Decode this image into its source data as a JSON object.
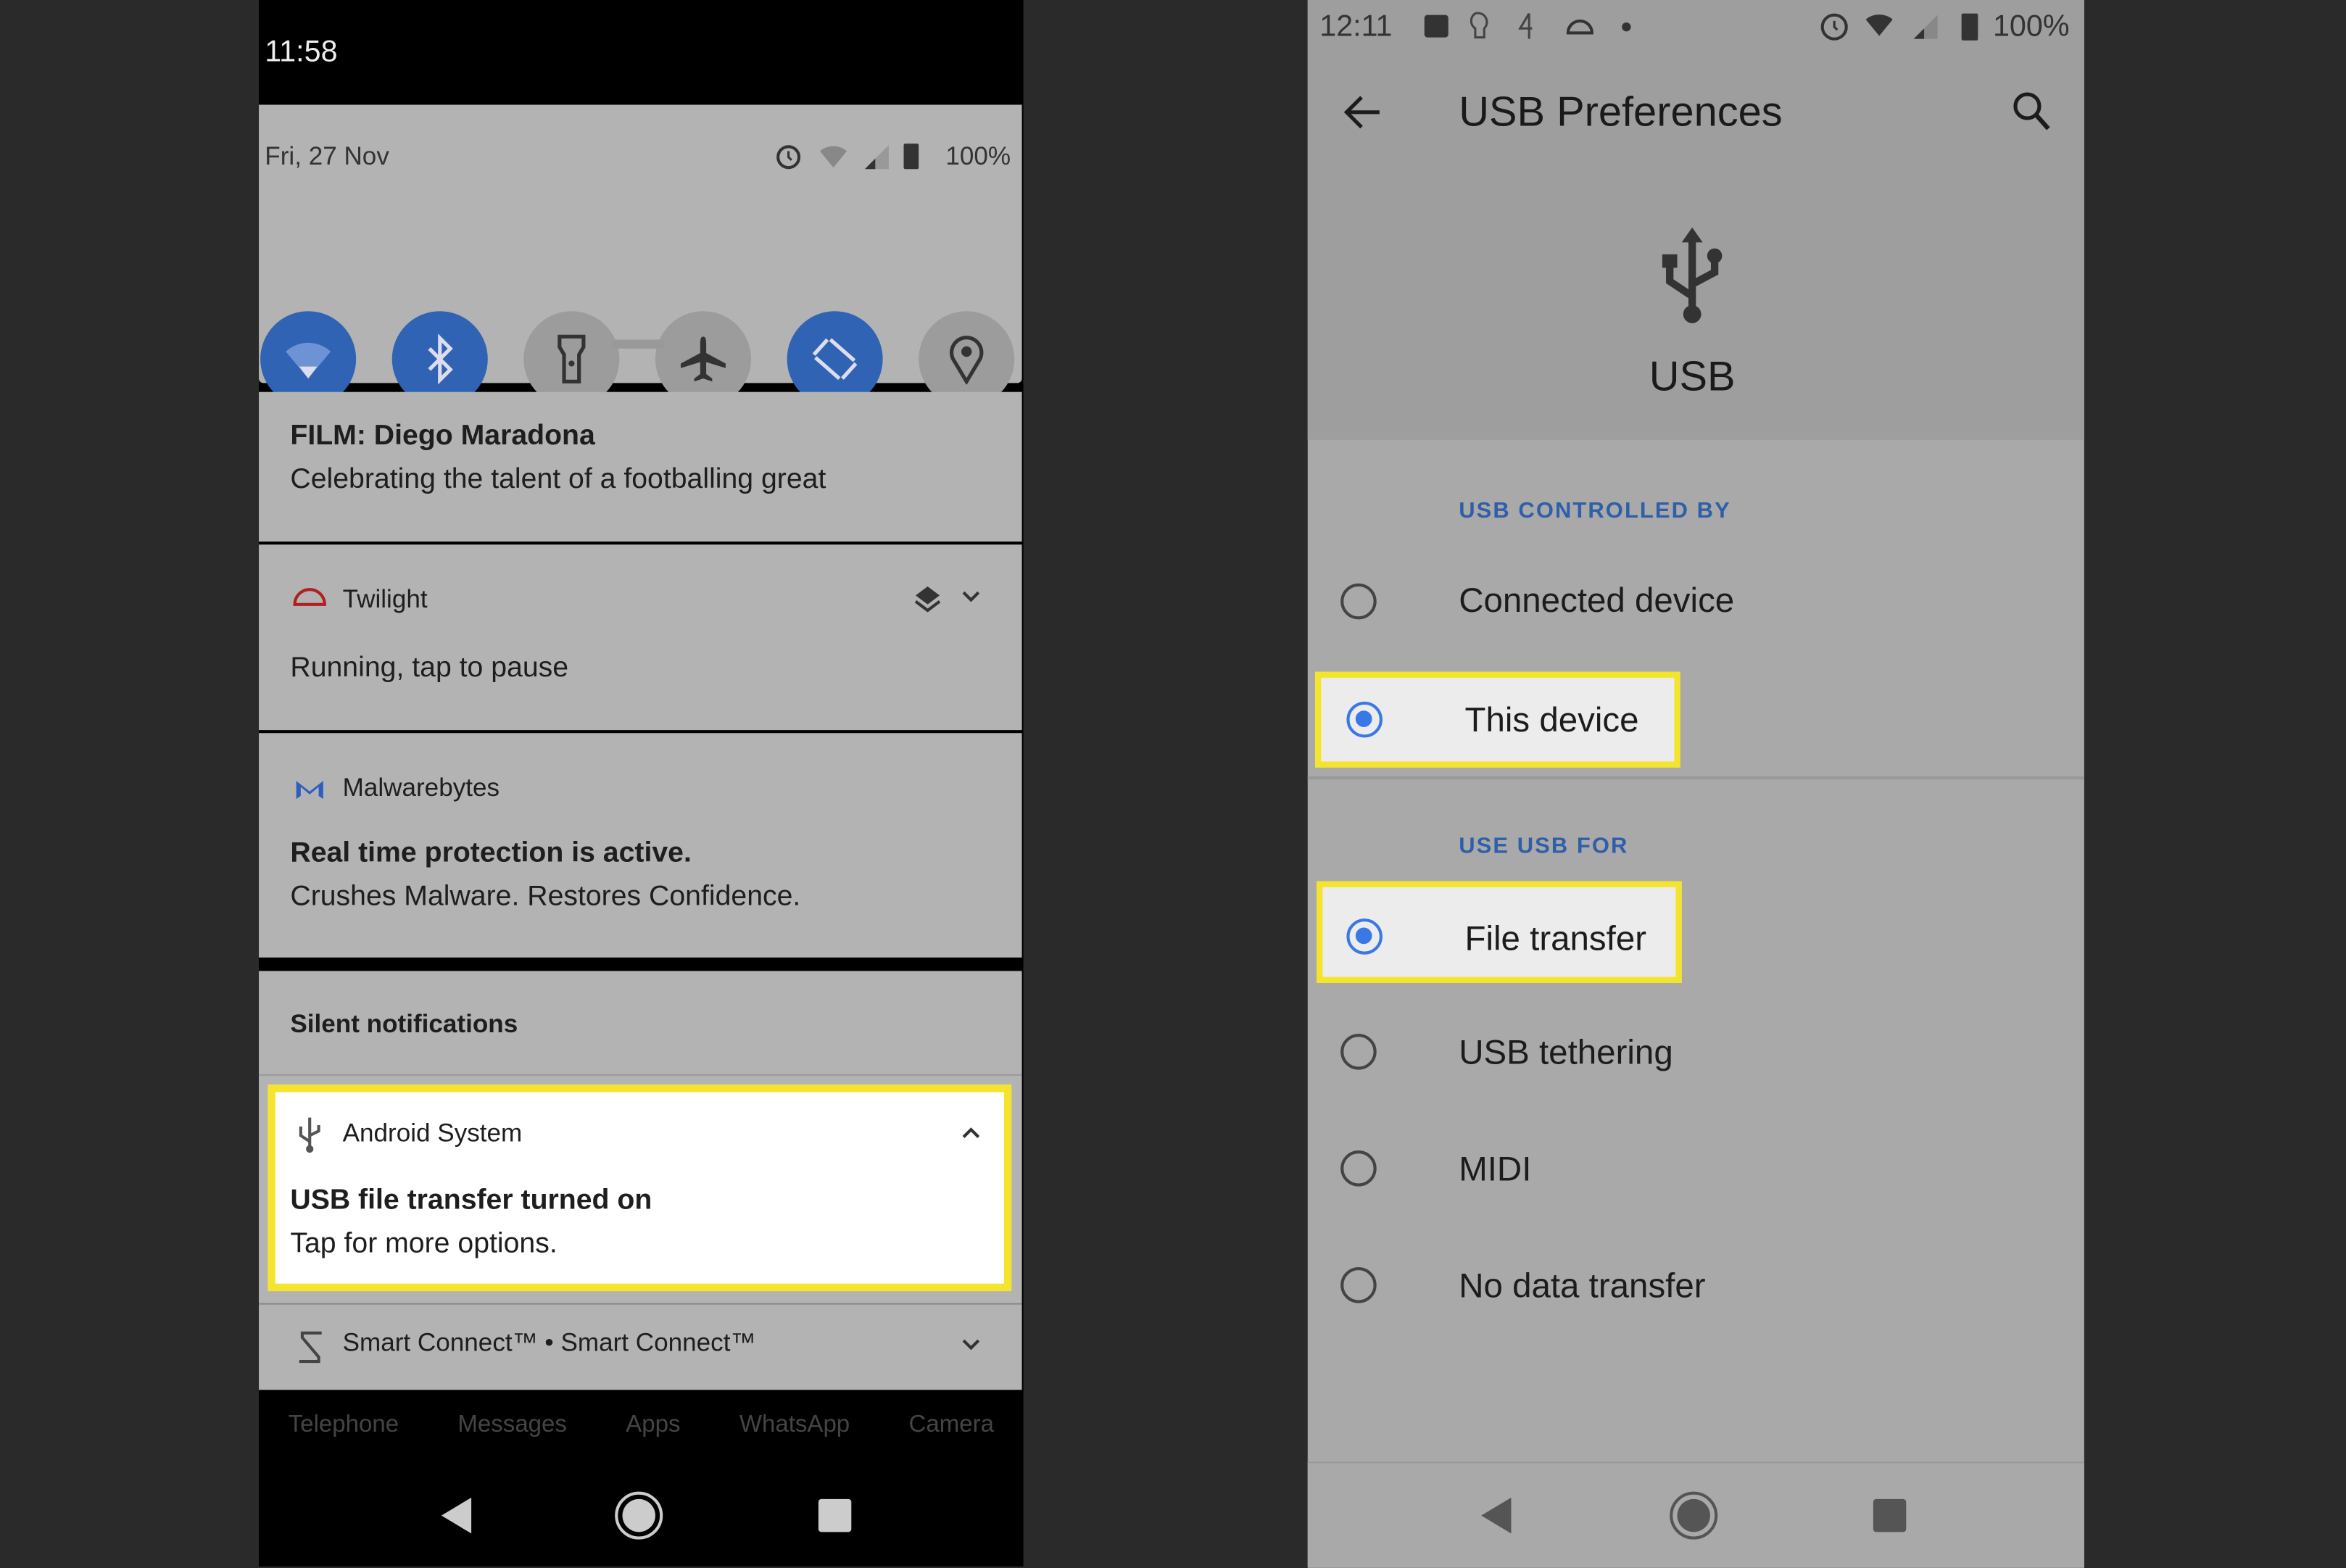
{
  "left": {
    "status_time": "11:58",
    "date": "Fri, 27 Nov",
    "battery": "100%",
    "quick_tiles": [
      {
        "icon": "wifi-icon",
        "active": true
      },
      {
        "icon": "bluetooth-icon",
        "active": true
      },
      {
        "icon": "flashlight-icon",
        "active": false
      },
      {
        "icon": "airplane-icon",
        "active": false
      },
      {
        "icon": "auto-rotate-icon",
        "active": true
      },
      {
        "icon": "location-icon",
        "active": false
      }
    ],
    "notifications": {
      "film_title": "FILM: Diego Maradona",
      "film_text": "Celebrating the talent of a footballing great",
      "twilight_app": "Twilight",
      "twilight_text": "Running, tap to pause",
      "malwarebytes_app": "Malwarebytes",
      "malwarebytes_title": "Real time protection is active.",
      "malwarebytes_text": "Crushes Malware. Restores Confidence.",
      "silent_header": "Silent notifications",
      "android_app": "Android System",
      "android_title": "USB file transfer turned on",
      "android_text": "Tap for more options.",
      "smart_connect": "Smart Connect™ • Smart Connect™"
    },
    "dock": [
      "Telephone",
      "Messages",
      "Apps",
      "WhatsApp",
      "Camera"
    ]
  },
  "right": {
    "status_time": "12:11",
    "battery": "100%",
    "title": "USB Preferences",
    "usb_label": "USB",
    "controlled_by_header": "USB CONTROLLED BY",
    "controlled_by": [
      {
        "label": "Connected device",
        "selected": false
      },
      {
        "label": "This device",
        "selected": true
      }
    ],
    "use_for_header": "USE USB FOR",
    "use_for": [
      {
        "label": "File transfer",
        "selected": true
      },
      {
        "label": "USB tethering",
        "selected": false
      },
      {
        "label": "MIDI",
        "selected": false
      },
      {
        "label": "No data transfer",
        "selected": false
      }
    ]
  },
  "colors": {
    "accent": "#3b78e7",
    "tile_active": "#3163b5",
    "highlight": "#f4e42b"
  }
}
